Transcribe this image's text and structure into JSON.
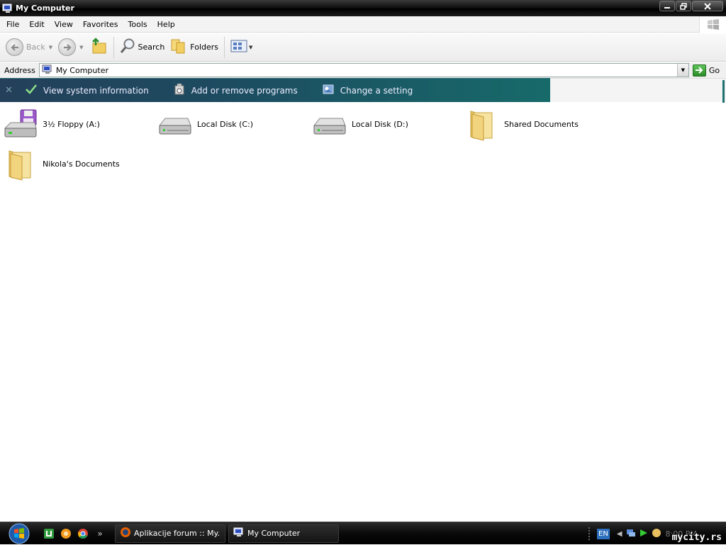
{
  "window": {
    "title": "My Computer",
    "icon": "my-computer-icon"
  },
  "menu": [
    "File",
    "Edit",
    "View",
    "Favorites",
    "Tools",
    "Help"
  ],
  "toolbar": {
    "back_label": "Back",
    "search_label": "Search",
    "folders_label": "Folders"
  },
  "address": {
    "label": "Address",
    "value": "My Computer",
    "go_label": "Go"
  },
  "tasks": [
    {
      "label": "View system information",
      "icon": "check-icon"
    },
    {
      "label": "Add or remove programs",
      "icon": "add-remove-programs-icon"
    },
    {
      "label": "Change a setting",
      "icon": "control-panel-icon"
    }
  ],
  "items": [
    {
      "label": "3½ Floppy (A:)",
      "icon": "floppy-drive-icon"
    },
    {
      "label": "Local Disk (C:)",
      "icon": "hard-disk-icon"
    },
    {
      "label": "Local Disk (D:)",
      "icon": "hard-disk-icon"
    },
    {
      "label": "Shared Documents",
      "icon": "folder-icon"
    },
    {
      "label": "Nikola's Documents",
      "icon": "folder-icon"
    }
  ],
  "taskbar": {
    "buttons": [
      {
        "label": "Aplikacije forum :: My...",
        "icon": "firefox-icon"
      },
      {
        "label": "My Computer",
        "icon": "my-computer-icon"
      }
    ],
    "language": "EN",
    "clock": "8:00 PM",
    "watermark": "mycity.rs"
  },
  "colors": {
    "titlebar": "#000000",
    "taskstrip_start": "#24405a",
    "taskstrip_end": "#176a6a",
    "taskbar": "#0a0a0a",
    "lang_badge": "#2c6fbf"
  }
}
